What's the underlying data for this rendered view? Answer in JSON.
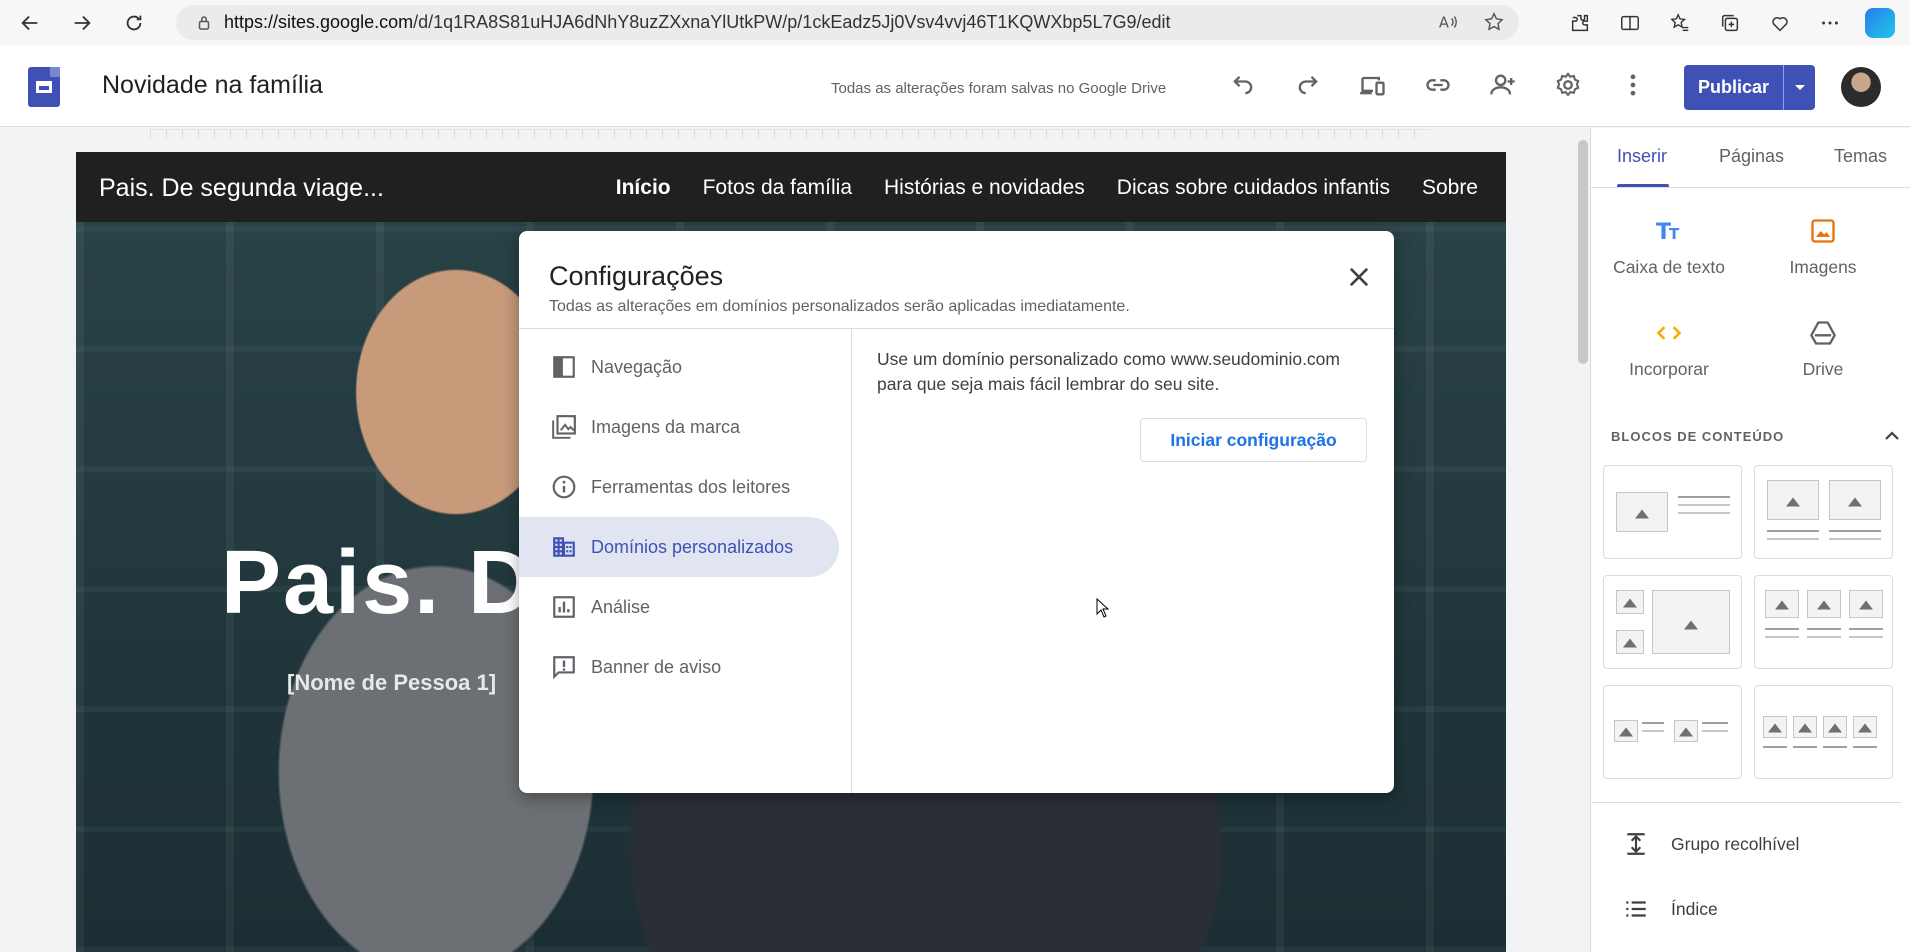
{
  "browser": {
    "url_domain": "https://sites.google.com",
    "url_path": "/d/1q1RA8S81uHJA6dNhY8uzZXxnaYlUtkPW/p/1ckEadz5Jj0Vsv4vvj46T1KQWXbp5L7G9/edit"
  },
  "header": {
    "site_title": "Novidade na família",
    "save_status": "Todas as alterações foram salvas no Google Drive",
    "publish_label": "Publicar"
  },
  "site": {
    "name": "Pais. De segunda viage...",
    "nav": [
      "Início",
      "Fotos da família",
      "Histórias e novidades",
      "Dicas sobre cuidados infantis",
      "Sobre"
    ],
    "hero_title": "Pais. De",
    "hero_subtitle": "[Nome de Pessoa 1]"
  },
  "dialog": {
    "title": "Configurações",
    "subtitle": "Todas as alterações em domínios personalizados serão aplicadas imediatamente.",
    "nav": [
      {
        "label": "Navegação",
        "icon": "navigation-icon"
      },
      {
        "label": "Imagens da marca",
        "icon": "brand-images-icon"
      },
      {
        "label": "Ferramentas dos leitores",
        "icon": "info-icon"
      },
      {
        "label": "Domínios personalizados",
        "icon": "domain-icon",
        "active": true
      },
      {
        "label": "Análise",
        "icon": "analytics-icon"
      },
      {
        "label": "Banner de aviso",
        "icon": "announcement-icon"
      }
    ],
    "content_line1": "Use um domínio personalizado como www.seudominio.com",
    "content_line2": "para que seja mais fácil lembrar do seu site.",
    "button_label": "Iniciar configuração"
  },
  "panel": {
    "tabs": [
      "Inserir",
      "Páginas",
      "Temas"
    ],
    "tools": [
      "Caixa de texto",
      "Imagens",
      "Incorporar",
      "Drive"
    ],
    "section_title": "BLOCOS DE CONTEÚDO",
    "items": [
      "Grupo recolhível",
      "Índice"
    ]
  },
  "colors": {
    "accent": "#3f51b5",
    "link_blue": "#1a73e8",
    "active_bg": "#e1e5f2"
  }
}
